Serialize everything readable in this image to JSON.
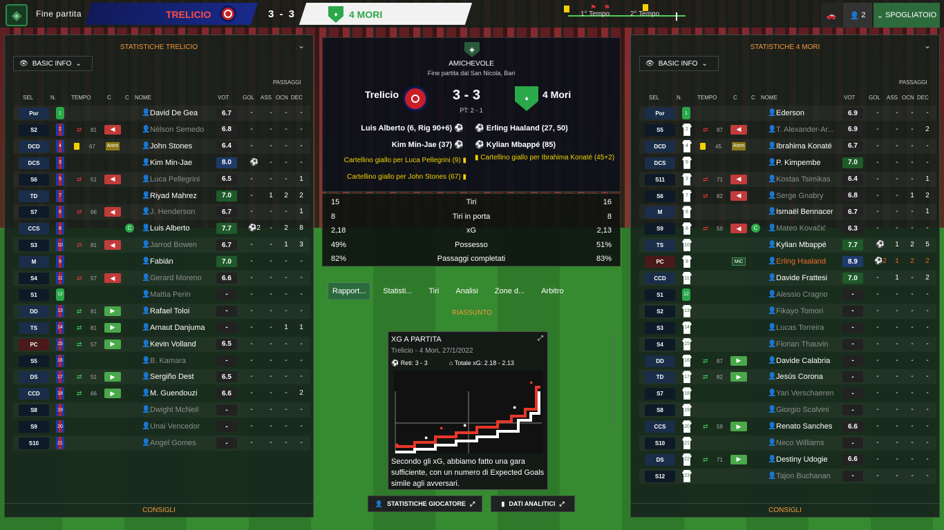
{
  "topbar": {
    "status": "Fine partita",
    "home_team": "TRELICIO",
    "score": "3 - 3",
    "away_team": "4 MORI",
    "first_half": "1° Tempo",
    "second_half": "2° Tempo",
    "people_count": "2",
    "spogliatoio": "SPOGLIATOIO"
  },
  "left_panel": {
    "title": "STATISTICHE TRELICIO",
    "view": "BASIC INFO",
    "footer": "CONSIGLI"
  },
  "right_panel": {
    "title": "STATISTICHE 4 MORI",
    "view": "BASIC INFO",
    "footer": "CONSIGLI"
  },
  "columns": {
    "passaggi": "PASSAGGI",
    "sel": "SEL",
    "n": "N.",
    "tempo": "TEMPO",
    "c": "C",
    "c2": "C",
    "nome": "NOME",
    "vot": "VOT",
    "gol": "GOL",
    "ass": "ASS",
    "ocn": "OCN",
    "dec": "DEC"
  },
  "home_players": [
    {
      "pos": "Por",
      "n": "1",
      "name": "David De Gea",
      "vote": "6.7",
      "gol": "-",
      "ass": "-",
      "ocn": "-",
      "dec": "-",
      "gk": true
    },
    {
      "pos": "S2",
      "n": "2",
      "name": "Nélson Semedo",
      "vote": "6.8",
      "gol": "-",
      "ass": "-",
      "ocn": "-",
      "dec": "-",
      "sub_out": "81",
      "dim": true
    },
    {
      "pos": "DCD",
      "n": "4",
      "name": "John Stones",
      "vote": "6.4",
      "gol": "-",
      "ass": "-",
      "ocn": "-",
      "dec": "-",
      "card": "67",
      "ctag": "Amm"
    },
    {
      "pos": "DCS",
      "n": "3",
      "name": "Kim Min-Jae",
      "vote": "8.0",
      "gol": "⚽",
      "ass": "-",
      "ocn": "-",
      "dec": "-"
    },
    {
      "pos": "S6",
      "n": "5",
      "name": "Luca Pellegrini",
      "vote": "6.5",
      "gol": "-",
      "ass": "-",
      "ocn": "-",
      "dec": "1",
      "sub_out": "51",
      "dim": true
    },
    {
      "pos": "TD",
      "n": "7",
      "name": "Riyad Mahrez",
      "vote": "7.0",
      "gol": "-",
      "ass": "1",
      "ocn": "2",
      "dec": "2"
    },
    {
      "pos": "S7",
      "n": "6",
      "name": "J. Henderson",
      "vote": "6.7",
      "gol": "-",
      "ass": "-",
      "ocn": "-",
      "dec": "1",
      "sub_out": "66",
      "dim": true
    },
    {
      "pos": "CCS",
      "n": "8",
      "name": "Luis Alberto",
      "vote": "7.7",
      "gol": "⚽2",
      "ass": "-",
      "ocn": "2",
      "dec": "8",
      "cap": "C"
    },
    {
      "pos": "S3",
      "n": "10",
      "name": "Jarrod Bowen",
      "vote": "6.7",
      "gol": "-",
      "ass": "-",
      "ocn": "1",
      "dec": "3",
      "sub_out": "81",
      "dim": true
    },
    {
      "pos": "M",
      "n": "9",
      "name": "Fabián",
      "vote": "7.0",
      "gol": "-",
      "ass": "-",
      "ocn": "-",
      "dec": "-"
    },
    {
      "pos": "S4",
      "n": "11",
      "name": "Gerard Moreno",
      "vote": "6.6",
      "gol": "-",
      "ass": "-",
      "ocn": "-",
      "dec": "-",
      "sub_out": "57",
      "dim": true
    },
    {
      "pos": "S1",
      "n": "12",
      "name": "Mattia Perin",
      "vote": "-",
      "gol": "-",
      "ass": "-",
      "ocn": "-",
      "dec": "-",
      "gk": true,
      "dim": true
    },
    {
      "pos": "DD",
      "n": "13",
      "name": "Rafael Toloi",
      "vote": "-",
      "gol": "-",
      "ass": "-",
      "ocn": "-",
      "dec": "-",
      "sub_in": "81"
    },
    {
      "pos": "TS",
      "n": "14",
      "name": "Arnaut Danjuma",
      "vote": "-",
      "gol": "-",
      "ass": "-",
      "ocn": "1",
      "dec": "1",
      "sub_in": "81"
    },
    {
      "pos": "PC",
      "n": "15",
      "name": "Kevin Volland",
      "vote": "6.5",
      "gol": "-",
      "ass": "-",
      "ocn": "-",
      "dec": "-",
      "sub_in": "57"
    },
    {
      "pos": "S5",
      "n": "16",
      "name": "B. Kamara",
      "vote": "-",
      "gol": "-",
      "ass": "-",
      "ocn": "-",
      "dec": "-",
      "dim": true
    },
    {
      "pos": "DS",
      "n": "17",
      "name": "Sergiño Dest",
      "vote": "6.5",
      "gol": "-",
      "ass": "-",
      "ocn": "-",
      "dec": "-",
      "sub_in": "51"
    },
    {
      "pos": "CCD",
      "n": "18",
      "name": "M. Guendouzi",
      "vote": "6.6",
      "gol": "-",
      "ass": "-",
      "ocn": "-",
      "dec": "2",
      "sub_in": "66"
    },
    {
      "pos": "S8",
      "n": "19",
      "name": "Dwight McNeil",
      "vote": "-",
      "gol": "-",
      "ass": "-",
      "ocn": "-",
      "dec": "-",
      "dim": true
    },
    {
      "pos": "S9",
      "n": "20",
      "name": "Unai Vencedor",
      "vote": "-",
      "gol": "-",
      "ass": "-",
      "ocn": "-",
      "dec": "-",
      "dim": true
    },
    {
      "pos": "S10",
      "n": "21",
      "name": "Angel Gomes",
      "vote": "-",
      "gol": "-",
      "ass": "-",
      "ocn": "-",
      "dec": "-",
      "dim": true
    }
  ],
  "away_players": [
    {
      "pos": "Por",
      "n": "1",
      "name": "Ederson",
      "vote": "6.9",
      "gol": "-",
      "ass": "-",
      "ocn": "-",
      "dec": "-",
      "gk": true
    },
    {
      "pos": "S5",
      "n": "2",
      "name": "T. Alexander-Ar...",
      "vote": "6.9",
      "gol": "-",
      "ass": "-",
      "ocn": "-",
      "dec": "2",
      "sub_out": "87",
      "dim": true
    },
    {
      "pos": "DCD",
      "n": "4",
      "name": "Ibrahima Konaté",
      "vote": "6.7",
      "gol": "-",
      "ass": "-",
      "ocn": "-",
      "dec": "-",
      "card": "45",
      "ctag": "Amm"
    },
    {
      "pos": "DCS",
      "n": "5",
      "name": "P. Kimpembe",
      "vote": "7.0",
      "gol": "-",
      "ass": "-",
      "ocn": "-",
      "dec": "-"
    },
    {
      "pos": "S11",
      "n": "3",
      "name": "Kostas Tsimikas",
      "vote": "6.4",
      "gol": "-",
      "ass": "-",
      "ocn": "-",
      "dec": "1",
      "sub_out": "71",
      "dim": true
    },
    {
      "pos": "S6",
      "n": "7",
      "name": "Serge Gnabry",
      "vote": "6.8",
      "gol": "-",
      "ass": "-",
      "ocn": "1",
      "dec": "2",
      "sub_out": "82",
      "dim": true
    },
    {
      "pos": "M",
      "n": "6",
      "name": "Ismaël Bennacer",
      "vote": "6.7",
      "gol": "-",
      "ass": "-",
      "ocn": "-",
      "dec": "1"
    },
    {
      "pos": "S9",
      "n": "8",
      "name": "Mateo Kovačić",
      "vote": "6.3",
      "gol": "-",
      "ass": "-",
      "ocn": "-",
      "dec": "-",
      "sub_out": "59",
      "cap": "C",
      "dim": true
    },
    {
      "pos": "TS",
      "n": "10",
      "name": "Kylian Mbappé",
      "vote": "7.7",
      "gol": "⚽",
      "ass": "1",
      "ocn": "2",
      "dec": "5"
    },
    {
      "pos": "PC",
      "n": "9",
      "name": "Erling Haaland",
      "vote": "8.9",
      "gol": "⚽2",
      "ass": "1",
      "ocn": "2",
      "dec": "2",
      "ctag": "MiC",
      "orange": true
    },
    {
      "pos": "CCD",
      "n": "11",
      "name": "Davide Frattesi",
      "vote": "7.0",
      "gol": "-",
      "ass": "1",
      "ocn": "-",
      "dec": "2"
    },
    {
      "pos": "S1",
      "n": "12",
      "name": "Alessio Cragno",
      "vote": "-",
      "gol": "-",
      "ass": "-",
      "ocn": "-",
      "dec": "-",
      "gk": true,
      "dim": true
    },
    {
      "pos": "S2",
      "n": "13",
      "name": "Fikayo Tomori",
      "vote": "-",
      "gol": "-",
      "ass": "-",
      "ocn": "-",
      "dec": "-",
      "dim": true
    },
    {
      "pos": "S3",
      "n": "14",
      "name": "Lucas Torreira",
      "vote": "-",
      "gol": "-",
      "ass": "-",
      "ocn": "-",
      "dec": "-",
      "dim": true
    },
    {
      "pos": "S4",
      "n": "15",
      "name": "Florian Thauvin",
      "vote": "-",
      "gol": "-",
      "ass": "-",
      "ocn": "-",
      "dec": "-",
      "dim": true
    },
    {
      "pos": "DD",
      "n": "16",
      "name": "Davide Calabria",
      "vote": "-",
      "gol": "-",
      "ass": "-",
      "ocn": "-",
      "dec": "-",
      "sub_in": "87"
    },
    {
      "pos": "TD",
      "n": "17",
      "name": "Jesús Corona",
      "vote": "-",
      "gol": "-",
      "ass": "-",
      "ocn": "-",
      "dec": "-",
      "sub_in": "82"
    },
    {
      "pos": "S7",
      "n": "18",
      "name": "Yari Verschaeren",
      "vote": "-",
      "gol": "-",
      "ass": "-",
      "ocn": "-",
      "dec": "-",
      "dim": true
    },
    {
      "pos": "S8",
      "n": "19",
      "name": "Giorgio Scalvini",
      "vote": "-",
      "gol": "-",
      "ass": "-",
      "ocn": "-",
      "dec": "-",
      "dim": true
    },
    {
      "pos": "CCS",
      "n": "20",
      "name": "Renato Sanches",
      "vote": "6.6",
      "gol": "-",
      "ass": "-",
      "ocn": "-",
      "dec": "-",
      "sub_in": "59"
    },
    {
      "pos": "S10",
      "n": "21",
      "name": "Neco Williams",
      "vote": "-",
      "gol": "-",
      "ass": "-",
      "ocn": "-",
      "dec": "-",
      "dim": true
    },
    {
      "pos": "DS",
      "n": "22",
      "name": "Destiny Udogie",
      "vote": "6.6",
      "gol": "-",
      "ass": "-",
      "ocn": "-",
      "dec": "-",
      "sub_in": "71"
    },
    {
      "pos": "S12",
      "n": "23",
      "name": "Tajon Buchanan",
      "vote": "-",
      "gol": "-",
      "ass": "-",
      "ocn": "-",
      "dec": "-",
      "dim": true
    }
  ],
  "match": {
    "competition": "AMICHEVOLE",
    "venue": "Fine partita dal San Nicola, Bari",
    "home": "Trelicio",
    "away": "4 Mori",
    "score": "3 - 3",
    "ht": "PT: 2 - 1",
    "home_events": [
      "Luis Alberto (6, Rig 90+6)",
      "Kim Min-Jae (37)",
      "Cartellino giallo per Luca Pellegrini (9)",
      "Cartellino giallo per John Stones (67)"
    ],
    "away_events": [
      "Erling Haaland (27, 50)",
      "Kylian Mbappé (85)",
      "Cartellino giallo per Ibrahima Konaté (45+2)"
    ]
  },
  "stats": [
    {
      "home": "15",
      "label": "Tiri",
      "away": "16"
    },
    {
      "home": "8",
      "label": "Tiri in porta",
      "away": "8"
    },
    {
      "home": "2,18",
      "label": "xG",
      "away": "2,13"
    },
    {
      "home": "49%",
      "label": "Possesso",
      "away": "51%"
    },
    {
      "home": "82%",
      "label": "Passaggi completati",
      "away": "83%"
    }
  ],
  "tabs": [
    "Rapport...",
    "Statisti...",
    "Tiri",
    "Analisi",
    "Zone d...",
    "Arbitro"
  ],
  "riassunto": "RIASSUNTO",
  "xg_card": {
    "title": "XG A PARTITA",
    "subtitle": "Trelicio - 4 Mori, 27/1/2022",
    "goals": "Reti: 3 - 3",
    "total": "Totale xG: 2.18 - 2.13",
    "text": "Secondo gli xG, abbiamo fatto una gara sufficiente, con un numero di Expected Goals simile agli avversari."
  },
  "buttons": {
    "player_stats": "STATISTICHE GIOCATORE",
    "analytics": "DATI ANALITICI"
  },
  "chart_data": {
    "type": "line",
    "title": "XG A PARTITA",
    "series": [
      {
        "name": "",
        "values": []
      },
      {
        "name": "",
        "values": []
      }
    ]
  },
  "colors": {
    "accent": "#f39a3c",
    "green": "#2aa84a",
    "home_red": "#c91e28"
  }
}
